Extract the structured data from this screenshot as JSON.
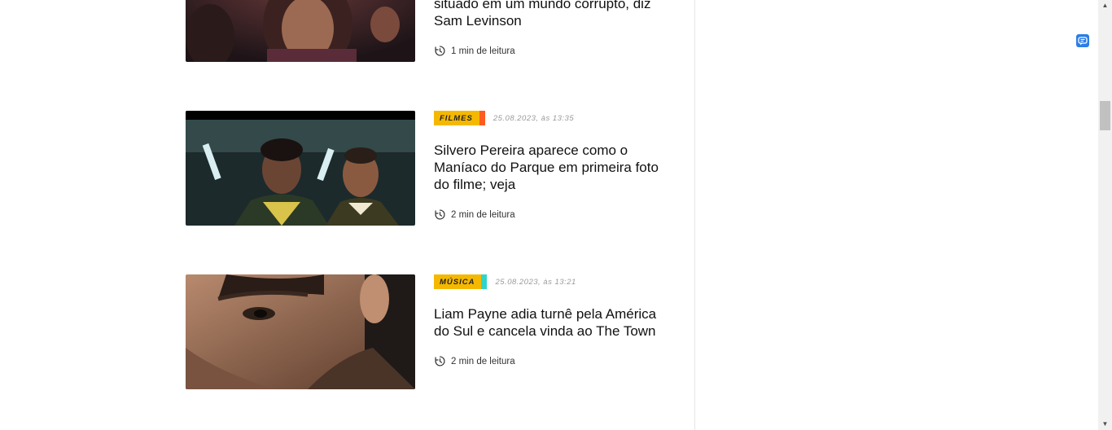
{
  "articles": [
    {
      "title": "situado em um mundo corrupto, diz Sam Levinson",
      "read_time": "1 min de leitura"
    },
    {
      "category": "FILMES",
      "category_color": "#f5b800",
      "category_tip_color": "#ff5a1f",
      "date": "25.08.2023, às 13:35",
      "title": "Silvero Pereira aparece como o Maníaco do Parque em primeira foto do filme; veja",
      "read_time": "2 min de leitura"
    },
    {
      "category": "MÚSICA",
      "category_color": "#f5b800",
      "category_tip_color": "#2fd6c8",
      "date": "25.08.2023, às 13:21",
      "title": "Liam Payne adia turnê pela América do Sul e cancela vinda ao The Town",
      "read_time": "2 min de leitura"
    }
  ],
  "icons": {
    "clock": "clock-history-icon",
    "extension": "translate-extension-icon",
    "scroll_up": "▲",
    "scroll_down": "▼"
  }
}
